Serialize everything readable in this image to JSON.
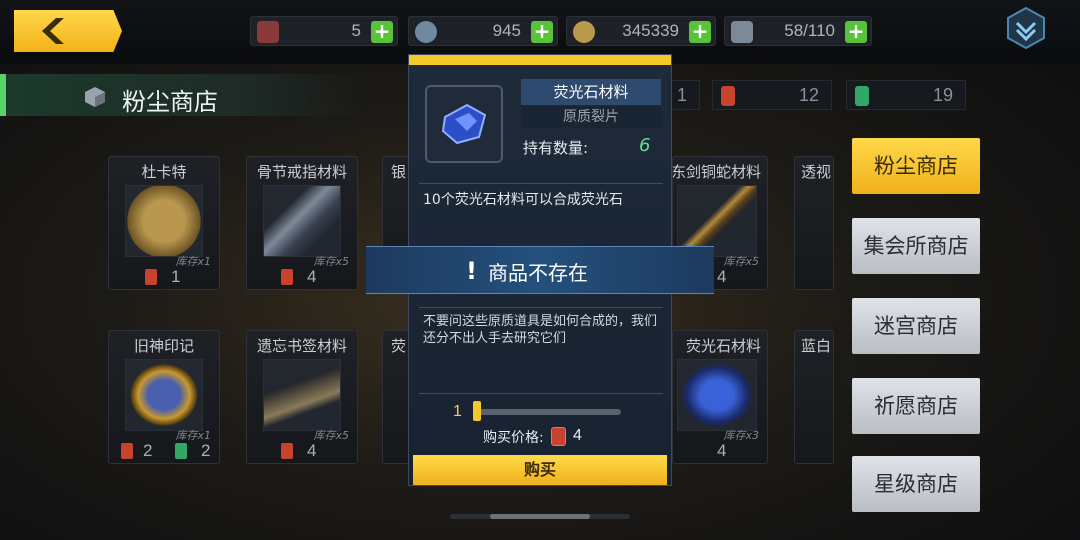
{
  "top_bar": {
    "resources": [
      {
        "icon": "ticket-icon",
        "value": "5"
      },
      {
        "icon": "crystal-icon",
        "value": "945"
      },
      {
        "icon": "gold-coin-icon",
        "value": "345339"
      },
      {
        "icon": "stamina-capsule-icon",
        "value": "58/110"
      }
    ]
  },
  "shop_title": "粉尘商店",
  "dust_currencies": [
    "1",
    "12",
    "19"
  ],
  "cards": [
    {
      "name": "杜卡特",
      "stock": "库存x1",
      "cost": "1"
    },
    {
      "name": "骨节戒指材料",
      "stock": "库存x5",
      "cost": "4"
    },
    {
      "name": "银"
    },
    {
      "name": "东剑铜蛇材料",
      "stock": "库存x5",
      "cost": "4"
    },
    {
      "name": "透视"
    },
    {
      "name": "旧神印记",
      "stock": "库存x1",
      "cost": "2",
      "cost2": "2"
    },
    {
      "name": "遗忘书签材料",
      "stock": "库存x5",
      "cost": "4"
    },
    {
      "name": "荧"
    },
    {
      "name": "荧光石材料",
      "stock": "库存x3",
      "cost": "4"
    },
    {
      "name": "蓝白"
    }
  ],
  "dialog": {
    "item_name": "荧光石材料",
    "item_type": "原质裂片",
    "owned_label": "持有数量:",
    "owned_value": "6",
    "desc1": "10个荧光石材料可以合成荧光石",
    "desc2": "不要问这些原质道具是如何合成的，我们还分不出人手去研究它们",
    "quantity": "1",
    "quantity_fraction": 0.0,
    "price_label": "购买价格:",
    "price_value": "4",
    "buy_label": "购买"
  },
  "toast": {
    "message": "商品不存在"
  },
  "tabs": [
    {
      "label": "粉尘商店",
      "active": true
    },
    {
      "label": "集会所商店",
      "active": false
    },
    {
      "label": "迷宫商店",
      "active": false
    },
    {
      "label": "祈愿商店",
      "active": false
    },
    {
      "label": "星级商店",
      "active": false
    }
  ],
  "colors": {
    "accent": "#f6c82a",
    "plus": "#58c23a",
    "owned": "#5de08a"
  }
}
